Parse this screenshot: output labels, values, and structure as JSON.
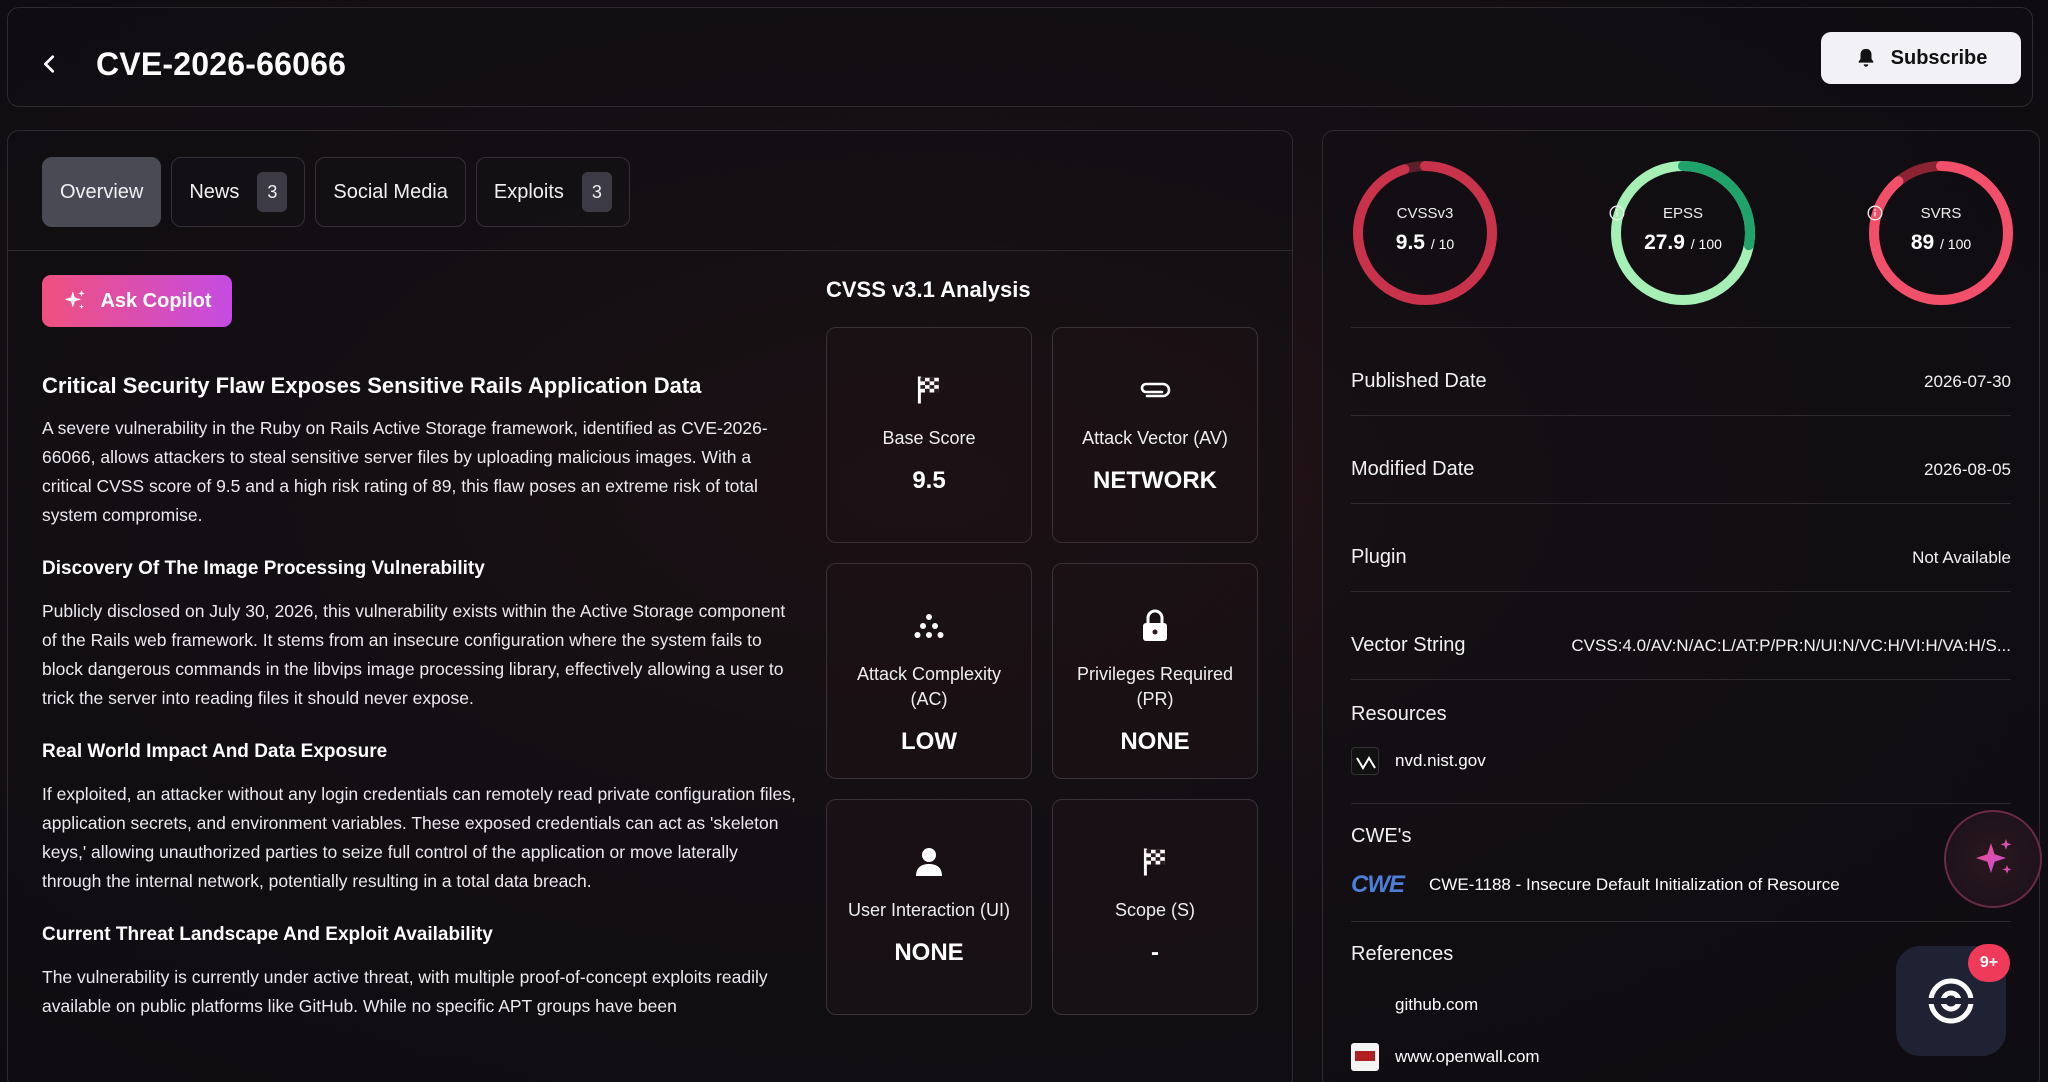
{
  "header": {
    "title": "CVE-2026-66066",
    "subscribe_label": "Subscribe"
  },
  "tabs": [
    {
      "label": "Overview",
      "count": ""
    },
    {
      "label": "News",
      "count": "3"
    },
    {
      "label": "Social Media",
      "count": ""
    },
    {
      "label": "Exploits",
      "count": "3"
    }
  ],
  "copilot_label": "Ask Copilot",
  "article": {
    "title": "Critical Security Flaw Exposes Sensitive Rails Application Data",
    "intro": "A severe vulnerability in the Ruby on Rails Active Storage framework, identified as CVE-2026-66066, allows attackers to steal sensitive server files by uploading malicious images. With a critical CVSS score of 9.5 and a high risk rating of 89, this flaw poses an extreme risk of total system compromise.",
    "sections": [
      {
        "heading": "Discovery Of The Image Processing Vulnerability",
        "body": "Publicly disclosed on July 30, 2026, this vulnerability exists within the Active Storage component of the Rails web framework. It stems from an insecure configuration where the system fails to block dangerous commands in the libvips image processing library, effectively allowing a user to trick the server into reading files it should never expose."
      },
      {
        "heading": "Real World Impact And Data Exposure",
        "body": "If exploited, an attacker without any login credentials can remotely read private configuration files, application secrets, and environment variables. These exposed credentials can act as 'skeleton keys,' allowing unauthorized parties to seize full control of the application or move laterally through the internal network, potentially resulting in a total data breach."
      },
      {
        "heading": "Current Threat Landscape And Exploit Availability",
        "body": "The vulnerability is currently under active threat, with multiple proof-of-concept exploits readily available on public platforms like GitHub. While no specific APT groups have been"
      }
    ]
  },
  "cvss_analysis": {
    "title": "CVSS v3.1 Analysis",
    "cards": [
      {
        "label": "Base Score",
        "value": "9.5",
        "icon": "flag-icon"
      },
      {
        "label": "Attack Vector (AV)",
        "value": "NETWORK",
        "icon": "paperclip-icon"
      },
      {
        "label": "Attack Complexity (AC)",
        "value": "LOW",
        "icon": "dots-icon"
      },
      {
        "label": "Privileges Required (PR)",
        "value": "NONE",
        "icon": "lock-icon"
      },
      {
        "label": "User Interaction (UI)",
        "value": "NONE",
        "icon": "user-icon"
      },
      {
        "label": "Scope (S)",
        "value": "-",
        "icon": "flag-icon"
      }
    ]
  },
  "gauges": [
    {
      "label": "CVSSv3",
      "value": "9.5",
      "max": "/ 10",
      "fraction": 0.95,
      "color": "#c8324a",
      "track": "#5a1f2a",
      "info": false
    },
    {
      "label": "EPSS",
      "value": "27.9",
      "max": "/ 100",
      "fraction": 0.279,
      "color": "#1fa36a",
      "track": "#a7f0b5",
      "info": true
    },
    {
      "label": "SVRS",
      "value": "89",
      "max": "/ 100",
      "fraction": 0.89,
      "color": "#f2506a",
      "track": "#8a2432",
      "info": true
    }
  ],
  "details": {
    "published_label": "Published Date",
    "published_value": "2026-07-30",
    "modified_label": "Modified Date",
    "modified_value": "2026-08-05",
    "plugin_label": "Plugin",
    "plugin_value": "Not Available",
    "vector_label": "Vector String",
    "vector_value": "CVSS:4.0/AV:N/AC:L/AT:P/PR:N/UI:N/VC:H/VI:H/VA:H/S..."
  },
  "resources": {
    "title": "Resources",
    "items": [
      "nvd.nist.gov"
    ]
  },
  "cwes": {
    "title": "CWE's",
    "logo_text": "CWE",
    "items": [
      "CWE-1188 - Insecure Default Initialization of Resource"
    ]
  },
  "references": {
    "title": "References",
    "items": [
      "github.com",
      "www.openwall.com"
    ]
  },
  "chat_badge": "9+",
  "colors": {
    "accent_pink": "#f0507e",
    "accent_purple": "#c54ce3",
    "background": "#0d0c10"
  }
}
